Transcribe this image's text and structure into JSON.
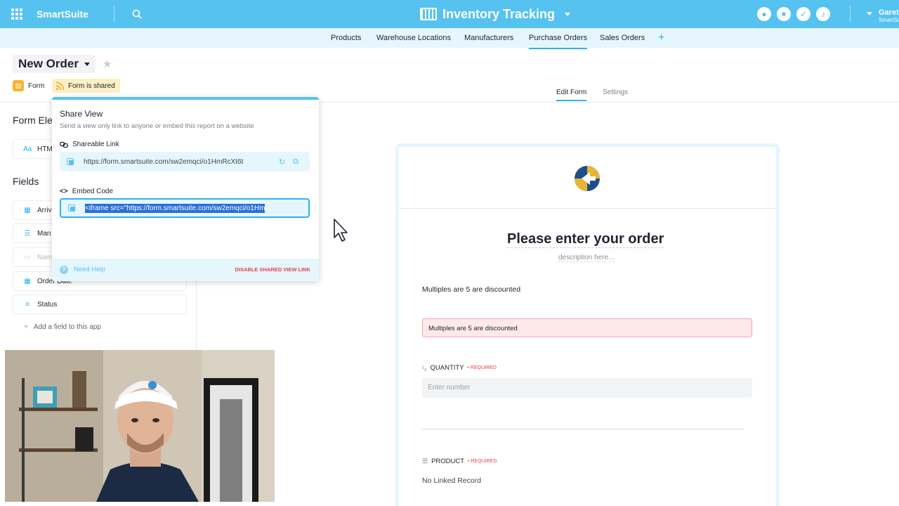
{
  "topbar": {
    "brand": "SmartSuite",
    "app_title": "Inventory Tracking",
    "user_name": "Gareth",
    "user_org": "SmartSuite"
  },
  "tabs": [
    {
      "label": "Products"
    },
    {
      "label": "Warehouse Locations"
    },
    {
      "label": "Manufacturers"
    },
    {
      "label": "Purchase Orders",
      "active": true
    },
    {
      "label": "Sales Orders"
    }
  ],
  "tab_add": "+",
  "view": {
    "title": "New Order",
    "badge_form": "Form",
    "badge_shared": "Form is shared"
  },
  "subtabs": {
    "edit_form": "Edit Form",
    "settings": "Settings"
  },
  "left_panel": {
    "form_elements_heading": "Form Ele",
    "elements": [
      {
        "icon": "Aa",
        "label": "HTM"
      }
    ],
    "fields_heading": "Fields",
    "fields": [
      {
        "icon": "calendar-icon",
        "label": "Arriv"
      },
      {
        "icon": "list-icon",
        "label": "Man"
      },
      {
        "icon": "text-icon",
        "label": "Nam",
        "dim": true
      },
      {
        "icon": "calendar-icon",
        "label": "Order Date"
      },
      {
        "icon": "status-icon",
        "label": "Status"
      }
    ],
    "add_field": "Add a field to this app"
  },
  "share_popover": {
    "title": "Share View",
    "subtitle": "Send a view only link to anyone or embed this report on a website",
    "link_label": "Shareable Link",
    "link_url": "https://form.smartsuite.com/sw2emqci/o1HmRcXt6t",
    "embed_label": "Embed Code",
    "embed_code": "<iframe src=\"https://form.smartsuite.com/sw2emqci/o1Hm",
    "help": "Need Help",
    "disable": "DISABLE SHARED VIEW LINK"
  },
  "form": {
    "title": "Please enter your order",
    "description": "description here...",
    "text_block": "Multiples are 5 are discounted",
    "alert_text": "Multiples are 5 are discounted",
    "quantity_label": "QUANTITY",
    "quantity_required": "• REQUIRED",
    "quantity_placeholder": "Enter number",
    "product_label": "PRODUCT",
    "product_required": "• REQUIRED",
    "product_value": "No Linked Record"
  },
  "colors": {
    "accent": "#55c2f0",
    "accent_light": "#e6f6fd",
    "danger": "#e2434f",
    "form_badge": "#f5b431"
  }
}
